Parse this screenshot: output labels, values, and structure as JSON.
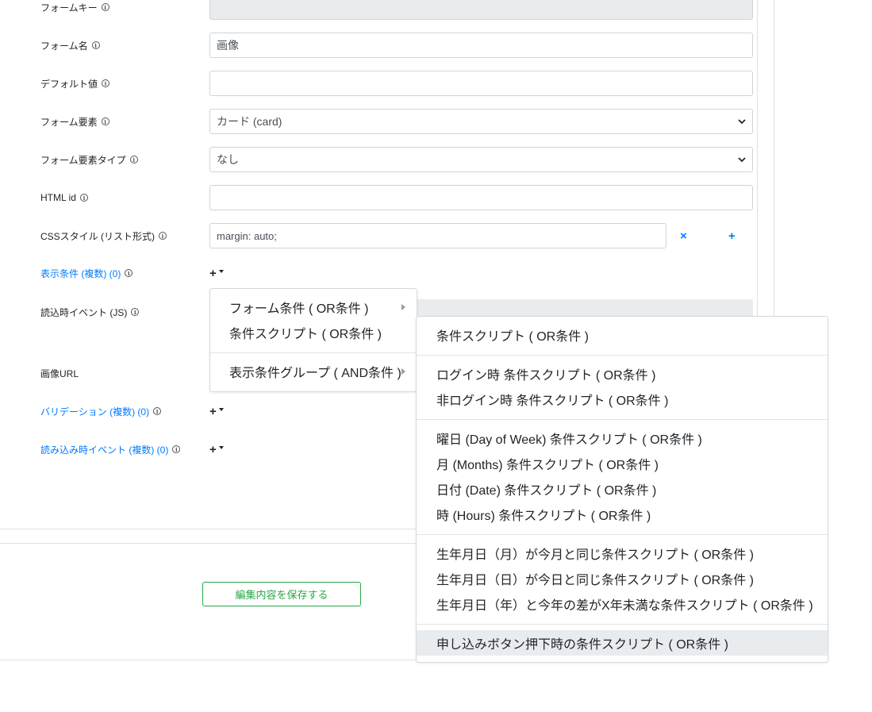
{
  "form": {
    "rows": [
      {
        "label": "フォームキー",
        "value": ""
      },
      {
        "label": "フォーム名",
        "value": "画像"
      },
      {
        "label": "デフォルト値",
        "value": ""
      },
      {
        "label": "フォーム要素",
        "value": "カード (card)"
      },
      {
        "label": "フォーム要素タイプ",
        "value": "なし"
      },
      {
        "label": "HTML id",
        "value": ""
      },
      {
        "label": "CSSスタイル (リスト形式)",
        "value": "margin: auto;"
      }
    ],
    "display_conditions_label": "表示条件 (複数) (0)",
    "onload_event_label": "読込時イベント (JS)",
    "image_url_label": "画像URL",
    "validation_label": "バリデーション (複数) (0)",
    "load_events_label": "読み込み時イベント (複数) (0)",
    "info_glyph": "i",
    "plus_glyph": "+",
    "remove_glyph": "×"
  },
  "save_button": "編集内容を保存する",
  "menu_primary": [
    {
      "label": "フォーム条件 ( OR条件 )",
      "has_submenu": true
    },
    {
      "label": "条件スクリプト ( OR条件 )",
      "has_submenu": false
    },
    {
      "label": "表示条件グループ ( AND条件 )",
      "has_submenu": true
    }
  ],
  "menu_secondary": {
    "groups": [
      [
        "条件スクリプト ( OR条件 )"
      ],
      [
        "ログイン時 条件スクリプト ( OR条件 )",
        "非ログイン時 条件スクリプト ( OR条件 )"
      ],
      [
        "曜日 (Day of Week) 条件スクリプト ( OR条件 )",
        "月 (Months) 条件スクリプト ( OR条件 )",
        "日付 (Date) 条件スクリプト ( OR条件 )",
        "時 (Hours) 条件スクリプト ( OR条件 )"
      ],
      [
        "生年月日（月）が今月と同じ条件スクリプト ( OR条件 )",
        "生年月日（日）が今日と同じ条件スクリプト ( OR条件 )",
        "生年月日（年）と今年の差がX年未満な条件スクリプト ( OR条件 )"
      ],
      [
        "申し込みボタン押下時の条件スクリプト ( OR条件 )"
      ]
    ],
    "highlighted": "申し込みボタン押下時の条件スクリプト ( OR条件 )"
  },
  "colors": {
    "link": "#007bff",
    "save": "#28a745",
    "border": "#ced4da",
    "disabled_bg": "#e9ecef"
  }
}
